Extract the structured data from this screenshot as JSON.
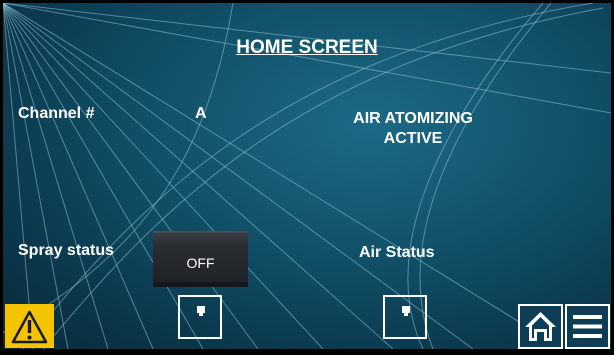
{
  "header": {
    "title": "HOME SCREEN"
  },
  "channel": {
    "label": "Channel #",
    "value": "A"
  },
  "mode": {
    "line1": "AIR ATOMIZING",
    "line2": "ACTIVE"
  },
  "spray": {
    "label": "Spray status",
    "button_label": "OFF"
  },
  "air": {
    "label": "Air Status"
  },
  "footer": {
    "warning_icon": "warning-triangle-icon",
    "home_icon": "home-icon",
    "menu_icon": "hamburger-menu-icon"
  },
  "colors": {
    "background": "#104e66",
    "warning": "#f5c400",
    "text": "#ffffff"
  }
}
